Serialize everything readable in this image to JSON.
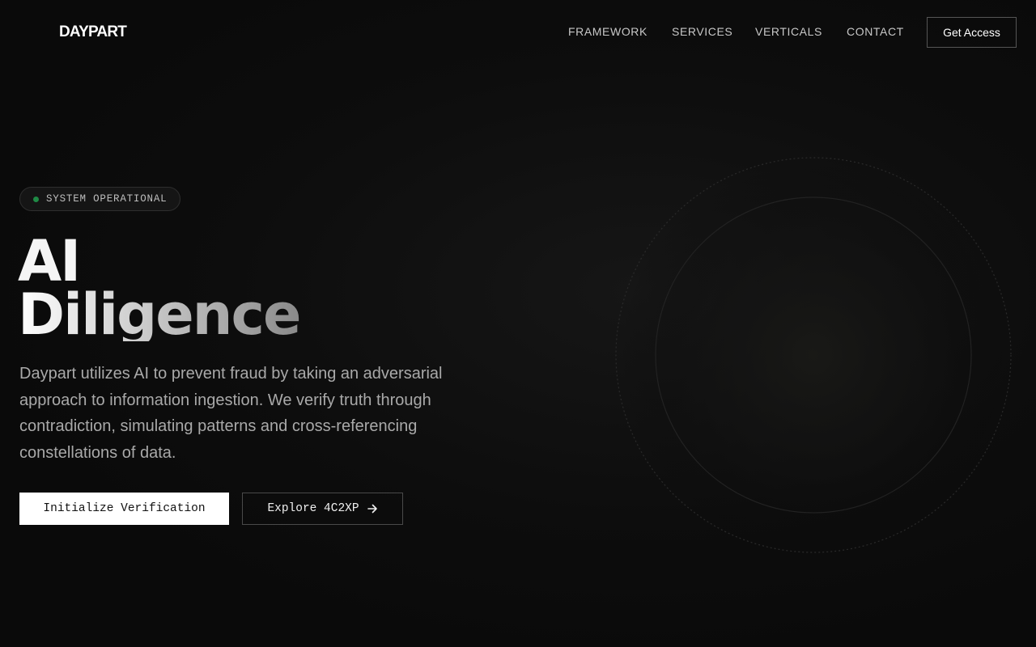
{
  "brand": {
    "logo_text": "DAYPART"
  },
  "nav": {
    "items": [
      {
        "label": "FRAMEWORK"
      },
      {
        "label": "SERVICES"
      },
      {
        "label": "VERTICALS"
      },
      {
        "label": "CONTACT"
      }
    ],
    "cta_label": "Get Access"
  },
  "hero": {
    "status": {
      "text": "SYSTEM OPERATIONAL",
      "dot_color": "#1f8a45"
    },
    "title_line1": "AI",
    "title_line2": "Diligence",
    "description": "Daypart utilizes AI to prevent fraud by taking an adversarial approach to information ingestion. We verify truth through contradiction, simulating patterns and cross-referencing constellations of data.",
    "primary_button": "Initialize Verification",
    "secondary_button": "Explore 4C2XP",
    "secondary_icon": "arrow-right-icon"
  },
  "colors": {
    "background": "#0a0a0a",
    "accent_status": "#1f8a45",
    "primary_button_bg": "#ffffff"
  }
}
